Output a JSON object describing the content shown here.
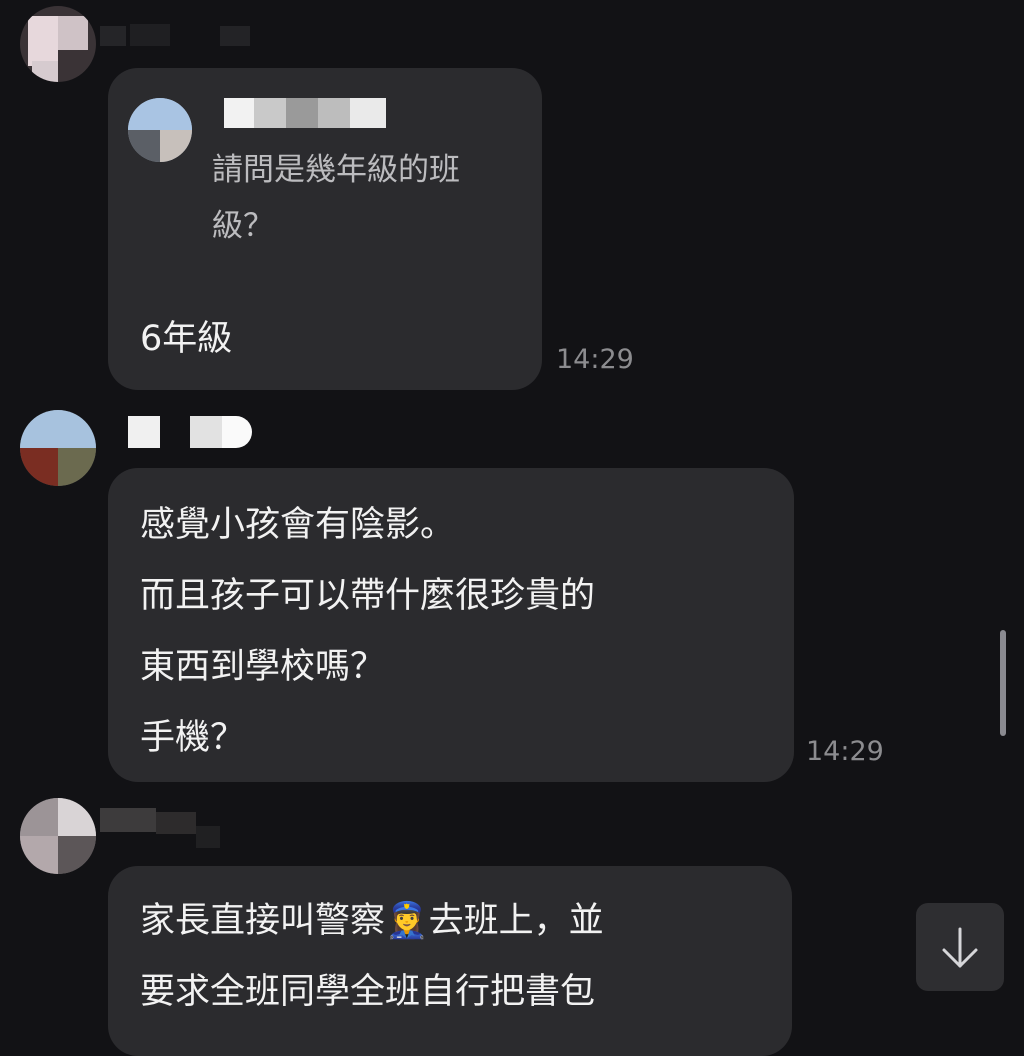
{
  "messages": [
    {
      "reply_preview": {
        "line1": "請問是幾年級的班",
        "line2": "級？"
      },
      "text": "6年級",
      "time": "14:29"
    },
    {
      "lines": [
        "感覺小孩會有陰影。",
        "而且孩子可以帶什麼很珍貴的",
        "東西到學校嗎？",
        "手機？"
      ],
      "time": "14:29"
    },
    {
      "line1_before": "家長直接叫警察",
      "emoji": "👮‍♀️",
      "line1_after": "去班上，並",
      "line2": "要求全班同學全班自行把書包"
    }
  ],
  "icons": {
    "scroll_down": "arrow-down-icon"
  },
  "colors": {
    "background": "#121215",
    "bubble": "#2b2b2e",
    "timestamp": "#8c8c8f"
  }
}
